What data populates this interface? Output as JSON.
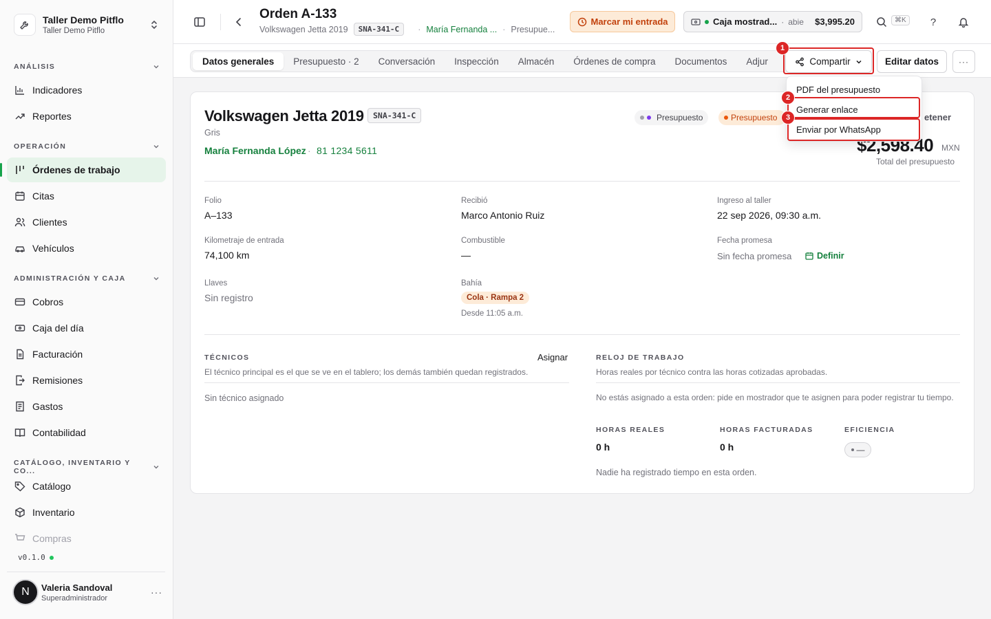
{
  "workspace": {
    "name": "Taller Demo Pitflo",
    "subtitle": "Taller Demo Pitflo"
  },
  "sidebar": {
    "sections": [
      {
        "title": "ANÁLISIS",
        "items": [
          "Indicadores",
          "Reportes"
        ]
      },
      {
        "title": "OPERACIÓN",
        "items": [
          "Órdenes de trabajo",
          "Citas",
          "Clientes",
          "Vehículos"
        ]
      },
      {
        "title": "ADMINISTRACIÓN Y CAJA",
        "items": [
          "Cobros",
          "Caja del día",
          "Facturación",
          "Remisiones",
          "Gastos",
          "Contabilidad"
        ]
      },
      {
        "title": "CATÁLOGO, INVENTARIO Y CO...",
        "items": [
          "Catálogo",
          "Inventario",
          "Compras"
        ]
      }
    ],
    "active_item": "Órdenes de trabajo",
    "version": "v0.1.0",
    "user": {
      "initial": "N",
      "name": "Valeria Sandoval",
      "role": "Superadministrador"
    }
  },
  "header": {
    "title": "Orden A-133",
    "vehicle": "Volkswagen Jetta 2019",
    "plate": "SNA-341-C",
    "client": "María Fernanda ...",
    "status": "Presupue...",
    "mark_entry": "Marcar mi entrada",
    "cash": {
      "name": "Caja mostrad...",
      "state": "abie",
      "amount": "$3,995.20"
    },
    "shortcut": "⌘K",
    "help": "?"
  },
  "tabs": [
    "Datos generales",
    "Presupuesto · 2",
    "Conversación",
    "Inspección",
    "Almacén",
    "Órdenes de compra",
    "Documentos",
    "Adjur"
  ],
  "actions": {
    "share": "Compartir",
    "edit": "Editar datos",
    "more": "···"
  },
  "share_menu": [
    "PDF del presupuesto",
    "Generar enlace",
    "Enviar por WhatsApp"
  ],
  "annotations": [
    "1",
    "2",
    "3"
  ],
  "vehicle_card": {
    "title": "Volkswagen Jetta 2019",
    "plate": "SNA-341-C",
    "color": "Gris",
    "client": "María Fernanda López",
    "phone": "81 1234 5611",
    "pill_stage": "Presupuesto",
    "pill_status": "Presupuesto",
    "stop": "etener",
    "total": "$2,598.40",
    "currency": "MXN",
    "total_label": "Total del presupuesto"
  },
  "fields": {
    "folio": {
      "label": "Folio",
      "value": "A–133"
    },
    "received": {
      "label": "Recibió",
      "value": "Marco Antonio Ruiz"
    },
    "entry": {
      "label": "Ingreso al taller",
      "value": "22 sep 2026, 09:30 a.m."
    },
    "mileage": {
      "label": "Kilometraje de entrada",
      "value": "74,100 km"
    },
    "fuel": {
      "label": "Combustible",
      "value": "—"
    },
    "promise": {
      "label": "Fecha promesa",
      "value": "Sin fecha promesa",
      "action": "Definir"
    },
    "keys": {
      "label": "Llaves",
      "value": "Sin registro"
    },
    "bay": {
      "label": "Bahía",
      "value": "Cola · Rampa 2",
      "since": "Desde 11:05 a.m."
    }
  },
  "technicians": {
    "title": "TÉCNICOS",
    "assign": "Asignar",
    "desc": "El técnico principal es el que se ve en el tablero; los demás también quedan registrados.",
    "empty": "Sin técnico asignado"
  },
  "clock": {
    "title": "RELOJ DE TRABAJO",
    "desc": "Horas reales por técnico contra las horas cotizadas aprobadas.",
    "note": "No estás asignado a esta orden: pide en mostrador que te asignen para poder registrar tu tiempo.",
    "real_label": "HORAS REALES",
    "real_value": "0 h",
    "billed_label": "HORAS FACTURADAS",
    "billed_value": "0 h",
    "eff_label": "EFICIENCIA",
    "eff_value": "—",
    "footer": "Nadie ha registrado tiempo en esta orden."
  },
  "colors": {
    "accent": "#16a34a",
    "highlight": "#dc2626",
    "warning_bg": "#fdebd8"
  }
}
